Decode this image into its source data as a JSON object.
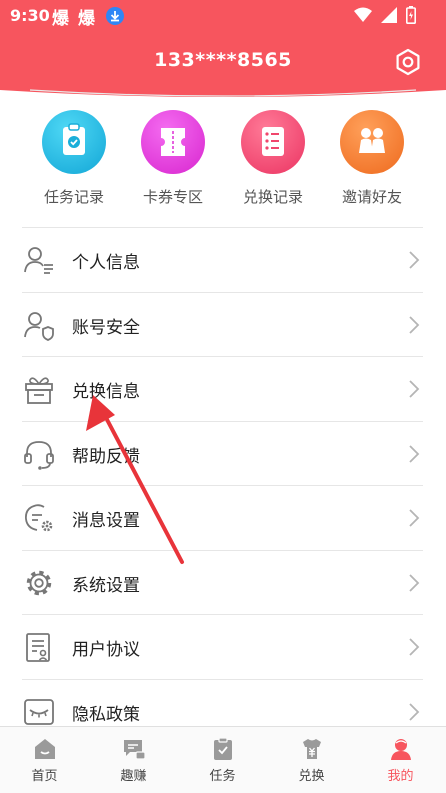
{
  "status_bar": {
    "time": "9:30",
    "app_name_1": "爆",
    "app_name_2": "爆"
  },
  "header": {
    "title": "133****8565"
  },
  "shortcuts": [
    {
      "label": "任务记录",
      "icon": "clipboard-check-icon",
      "color": "#1fb6e0"
    },
    {
      "label": "卡券专区",
      "icon": "ticket-icon",
      "color": "#e53bd9"
    },
    {
      "label": "兑换记录",
      "icon": "list-icon",
      "color": "#f2466f"
    },
    {
      "label": "邀请好友",
      "icon": "people-icon",
      "color": "#f47a2c"
    }
  ],
  "menu": [
    {
      "label": "个人信息",
      "icon": "user-info-icon"
    },
    {
      "label": "账号安全",
      "icon": "user-shield-icon"
    },
    {
      "label": "兑换信息",
      "icon": "gift-icon"
    },
    {
      "label": "帮助反馈",
      "icon": "headset-icon"
    },
    {
      "label": "消息设置",
      "icon": "message-settings-icon"
    },
    {
      "label": "系统设置",
      "icon": "gear-icon"
    },
    {
      "label": "用户协议",
      "icon": "document-icon"
    },
    {
      "label": "隐私政策",
      "icon": "privacy-eye-icon"
    }
  ],
  "bottom_nav": [
    {
      "label": "首页",
      "icon": "home-icon"
    },
    {
      "label": "趣赚",
      "icon": "chat-icon"
    },
    {
      "label": "任务",
      "icon": "task-icon"
    },
    {
      "label": "兑换",
      "icon": "exchange-icon"
    },
    {
      "label": "我的",
      "icon": "profile-icon",
      "active": true
    }
  ],
  "colors": {
    "brand": "#f7555e",
    "arrow": "#e8343a"
  }
}
